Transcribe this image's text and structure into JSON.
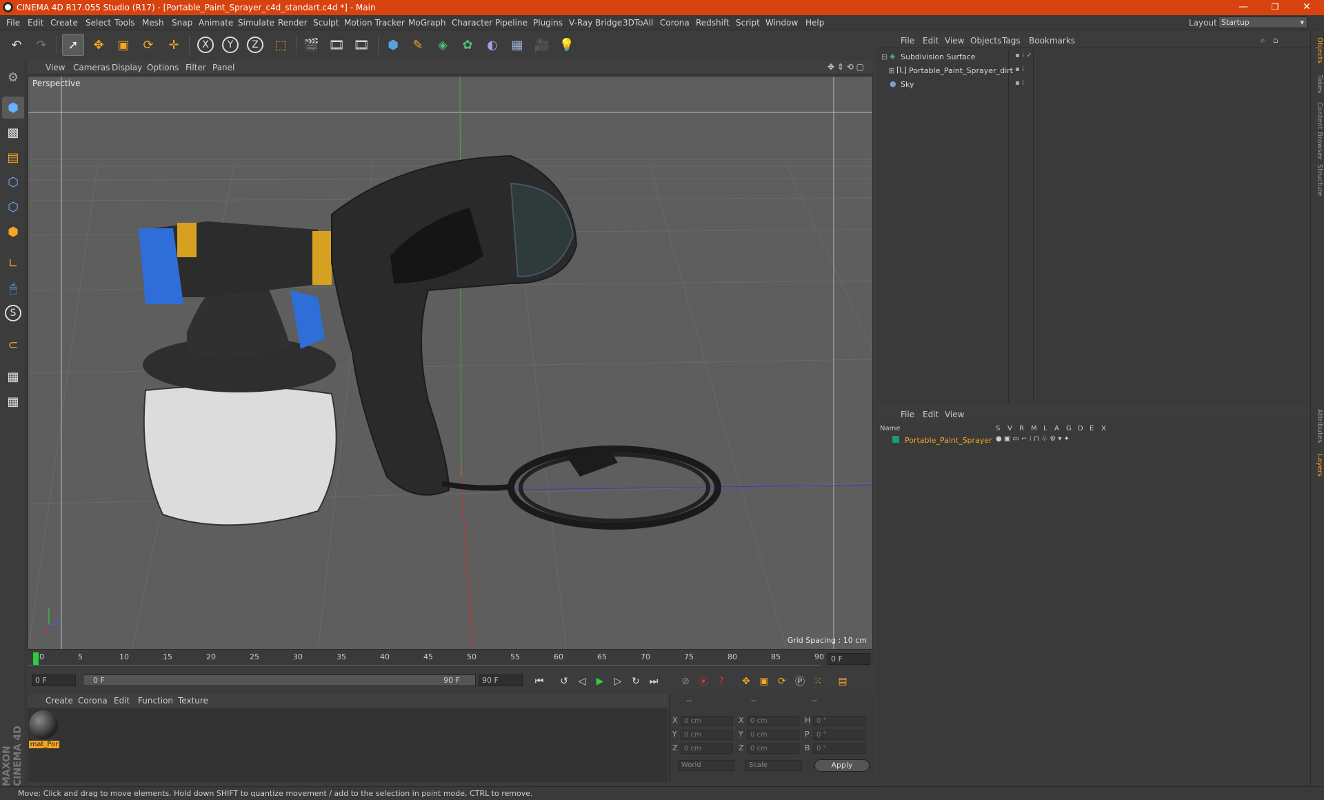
{
  "window": {
    "title": "CINEMA 4D R17.055 Studio (R17) - [Portable_Paint_Sprayer_c4d_standart.c4d *] - Main",
    "min_label": "—",
    "max_label": "❐",
    "close_label": "✕"
  },
  "menu": [
    "File",
    "Edit",
    "Create",
    "Select",
    "Tools",
    "Mesh",
    "Snap",
    "Animate",
    "Simulate",
    "Render",
    "Sculpt",
    "Motion Tracker",
    "MoGraph",
    "Character",
    "Pipeline",
    "Plugins",
    "V-Ray Bridge",
    "3DToAll",
    "Corona",
    "Redshift",
    "Script",
    "Window",
    "Help"
  ],
  "layout": {
    "label": "Layout:",
    "value": "Startup"
  },
  "viewport": {
    "menu": [
      "View",
      "Cameras",
      "Display",
      "Options",
      "Filter",
      "Panel"
    ],
    "label": "Perspective",
    "grid_spacing": "Grid Spacing : 10 cm"
  },
  "timeline": {
    "ticks": [
      "0",
      "5",
      "10",
      "15",
      "20",
      "25",
      "30",
      "35",
      "40",
      "45",
      "50",
      "55",
      "60",
      "65",
      "70",
      "75",
      "80",
      "85",
      "90"
    ],
    "current_frame": "0 F",
    "start_field": "0 F",
    "range_start": "0 F",
    "range_end": "90 F",
    "end_field": "90 F"
  },
  "material_manager": {
    "menu": [
      "Create",
      "Corona",
      "Edit",
      "Function",
      "Texture"
    ],
    "materials": [
      {
        "name": "mat_Por"
      }
    ]
  },
  "coordinates": {
    "headers": [
      "--",
      "--",
      "--"
    ],
    "rows": [
      {
        "a": "X",
        "av": "0 cm",
        "b": "X",
        "bv": "0 cm",
        "c": "H",
        "cv": "0 °"
      },
      {
        "a": "Y",
        "av": "0 cm",
        "b": "Y",
        "bv": "0 cm",
        "c": "P",
        "cv": "0 °"
      },
      {
        "a": "Z",
        "av": "0 cm",
        "b": "Z",
        "bv": "0 cm",
        "c": "B",
        "cv": "0 °"
      }
    ],
    "mode1": "World",
    "mode2": "Scale",
    "apply": "Apply"
  },
  "object_manager": {
    "menu": [
      "File",
      "Edit",
      "View",
      "Objects",
      "Tags",
      "Bookmarks"
    ],
    "objects": [
      {
        "name": "Subdivision Surface",
        "color": "#3fbf8f"
      },
      {
        "name": "Portable_Paint_Sprayer_dirt",
        "color": "#e0e0e0"
      },
      {
        "name": "Sky",
        "color": "#7aa0d0"
      }
    ]
  },
  "layer_manager": {
    "menu": [
      "File",
      "Edit",
      "View"
    ],
    "columns": [
      "Name",
      "S",
      "V",
      "R",
      "M",
      "L",
      "A",
      "G",
      "D",
      "E",
      "X"
    ],
    "layers": [
      {
        "name": "Portable_Paint_Sprayer",
        "color": "#1a9a7a"
      }
    ]
  },
  "side_tabs": [
    "Objects",
    "Takes",
    "Content Browser",
    "Structure",
    "Attributes",
    "Layers"
  ],
  "brand": "MAXON CINEMA 4D",
  "status": "Move: Click and drag to move elements. Hold down SHIFT to quantize movement / add to the selection in point mode, CTRL to remove."
}
